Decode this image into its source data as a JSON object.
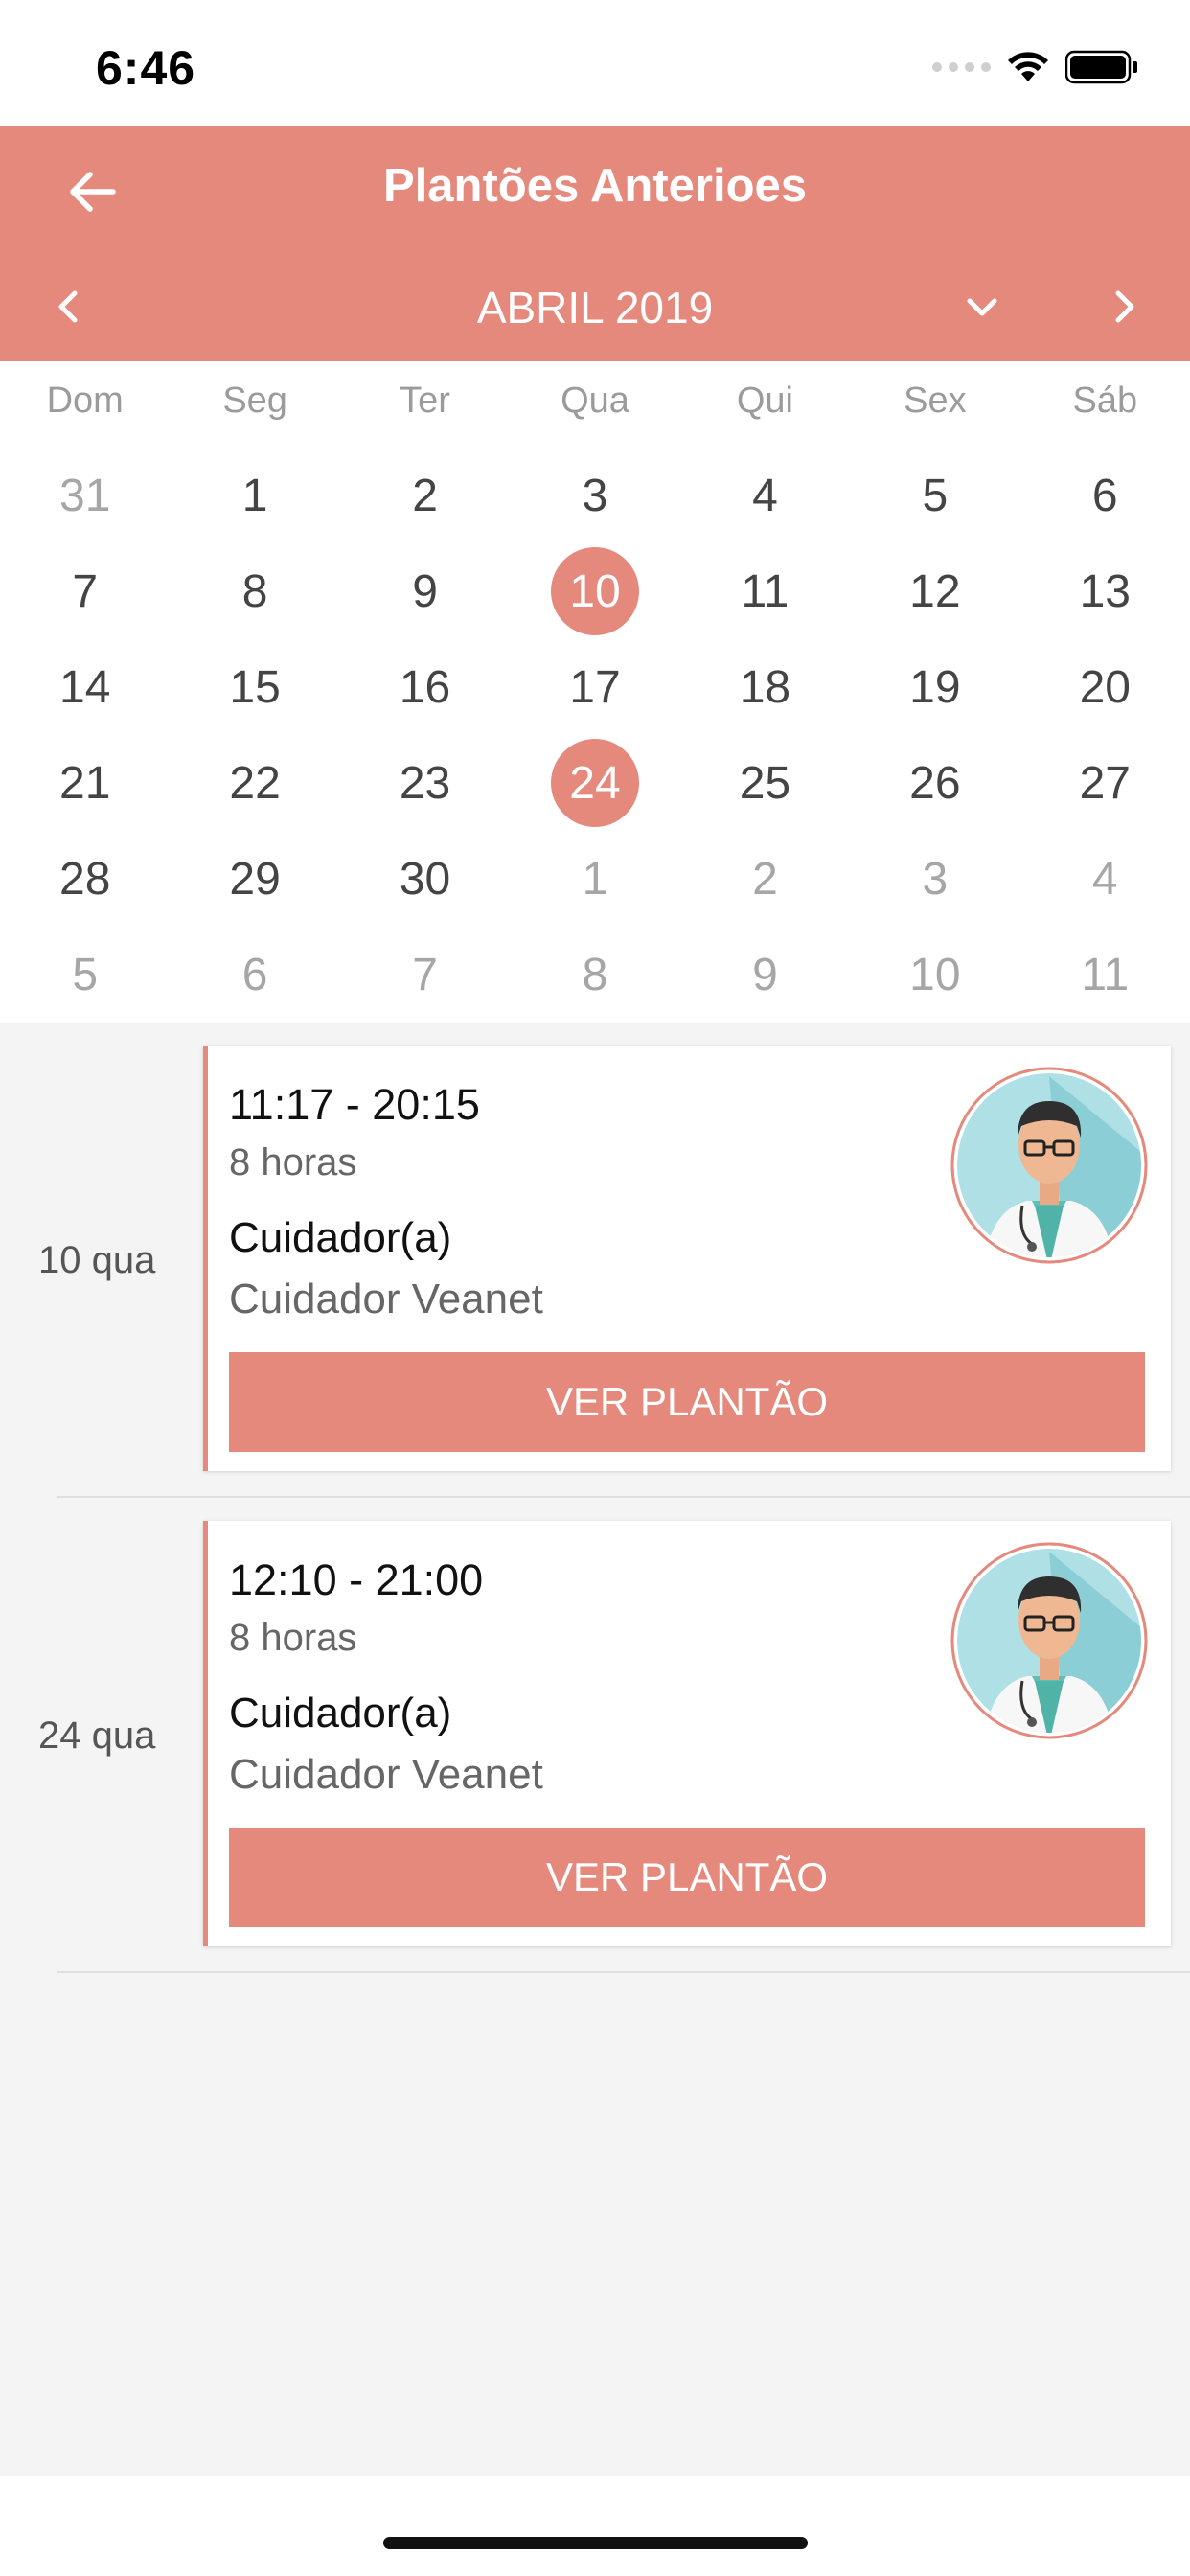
{
  "status_bar": {
    "time": "6:46"
  },
  "header": {
    "title": "Plantões Anterioes",
    "month_label": "ABRIL 2019"
  },
  "calendar": {
    "weekdays": [
      "Dom",
      "Seg",
      "Ter",
      "Qua",
      "Qui",
      "Sex",
      "Sáb"
    ],
    "weeks": [
      [
        "31",
        "1",
        "2",
        "3",
        "4",
        "5",
        "6"
      ],
      [
        "7",
        "8",
        "9",
        "10",
        "11",
        "12",
        "13"
      ],
      [
        "14",
        "15",
        "16",
        "17",
        "18",
        "19",
        "20"
      ],
      [
        "21",
        "22",
        "23",
        "24",
        "25",
        "26",
        "27"
      ],
      [
        "28",
        "29",
        "30",
        "1",
        "2",
        "3",
        "4"
      ],
      [
        "5",
        "6",
        "7",
        "8",
        "9",
        "10",
        "11"
      ]
    ],
    "muted_positions": [
      "0-0",
      "4-3",
      "4-4",
      "4-5",
      "4-6",
      "5-0",
      "5-1",
      "5-2",
      "5-3",
      "5-4",
      "5-5",
      "5-6"
    ],
    "selected_positions": [
      "1-3",
      "3-3"
    ]
  },
  "shifts": [
    {
      "date": "10 qua",
      "time": "11:17 - 20:15",
      "duration": "8 horas",
      "role": "Cuidador(a)",
      "name": "Cuidador Veanet",
      "button": "VER PLANTÃO"
    },
    {
      "date": "24 qua",
      "time": "12:10 - 21:00",
      "duration": "8 horas",
      "role": "Cuidador(a)",
      "name": "Cuidador Veanet",
      "button": "VER PLANTÃO"
    }
  ],
  "colors": {
    "accent": "#e5897d",
    "list_background": "#f4f4f4"
  },
  "icons": {
    "back": "arrow-left-icon",
    "prev": "chevron-left-icon",
    "next": "chevron-right-icon",
    "month_dropdown": "chevron-down-icon",
    "avatar": "doctor-avatar-icon"
  }
}
